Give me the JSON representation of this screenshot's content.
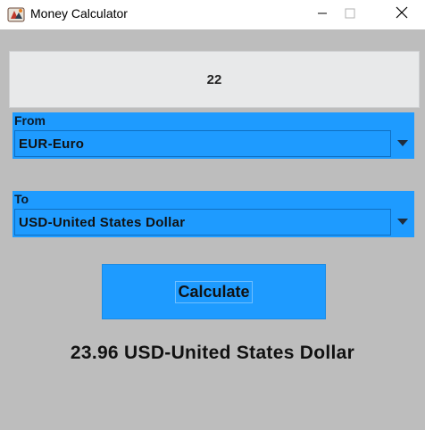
{
  "window": {
    "title": "Money Calculator",
    "icons": {
      "app": "money-calculator-app-icon",
      "minimize": "minimize-icon",
      "maximize": "maximize-icon",
      "close": "close-icon"
    }
  },
  "amount": {
    "value": "22"
  },
  "from": {
    "label": "From",
    "selected": "EUR-Euro",
    "arrow_icon": "dropdown-arrow-icon"
  },
  "to": {
    "label": "To",
    "selected": "USD-United States Dollar",
    "arrow_icon": "dropdown-arrow-icon"
  },
  "calculate": {
    "label": "Calculate"
  },
  "result": {
    "text": "23.96 USD-United States Dollar"
  },
  "colors": {
    "accent": "#1e9bff",
    "background": "#bdbdbd",
    "field": "#e8e9ea"
  }
}
